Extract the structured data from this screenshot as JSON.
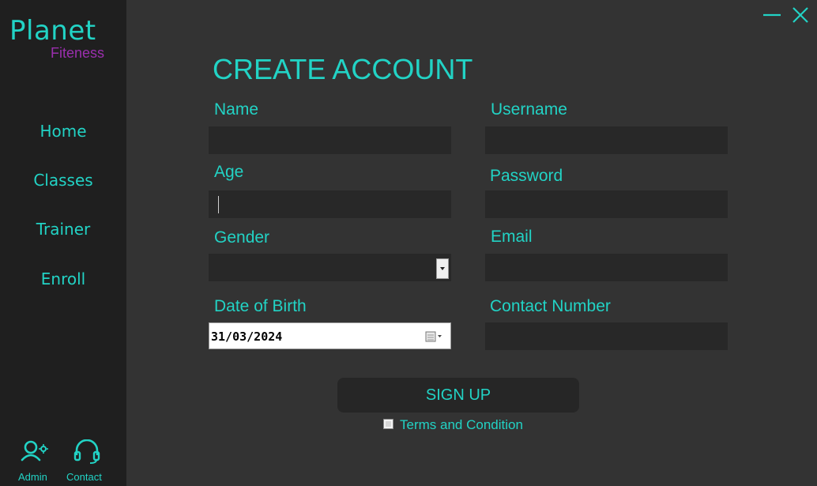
{
  "brand": {
    "title": "Planet",
    "subtitle": "Fiteness"
  },
  "sidebar": {
    "items": [
      {
        "label": "Home"
      },
      {
        "label": "Classes"
      },
      {
        "label": "Trainer"
      },
      {
        "label": "Enroll"
      }
    ],
    "bottom": [
      {
        "label": "Admin",
        "icon": "user-gear-icon"
      },
      {
        "label": "Contact",
        "icon": "headset-icon"
      }
    ]
  },
  "window": {
    "minimize_icon": "minimize-icon",
    "close_icon": "close-icon"
  },
  "form": {
    "title": "CREATE ACCOUNT",
    "name_label": "Name",
    "username_label": "Username",
    "age_label": "Age",
    "password_label": "Password",
    "gender_label": "Gender",
    "email_label": "Email",
    "dob_label": "Date of Birth",
    "dob_value": "31/03/2024",
    "contact_label": "Contact Number",
    "name_value": "",
    "username_value": "",
    "age_value": "",
    "password_value": "",
    "gender_value": "",
    "email_value": "",
    "contact_value": "",
    "signup_label": "SIGN UP",
    "terms_label": "Terms and Condition",
    "terms_checked": false
  },
  "colors": {
    "accent": "#22d3c5",
    "brand_sub": "#9b2fae",
    "sidebar_bg": "#1f1f1f",
    "main_bg": "#333333",
    "field_bg": "#282828"
  }
}
